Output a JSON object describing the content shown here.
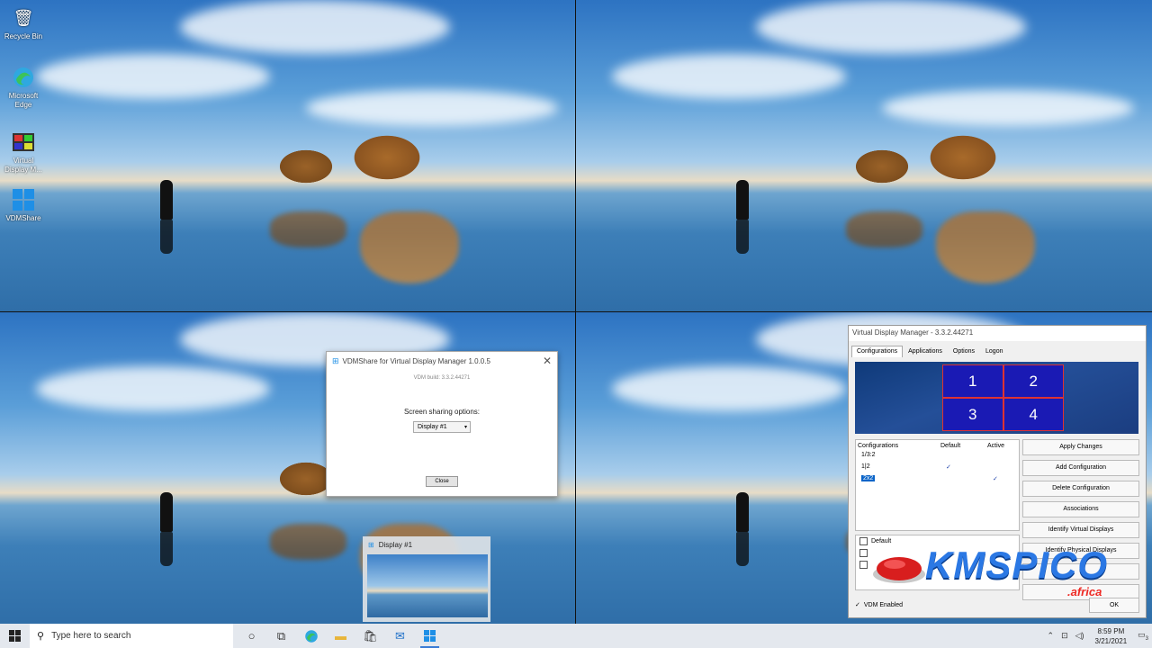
{
  "desktop": {
    "icons": [
      {
        "label": "Recycle Bin",
        "icon": "recycle-bin-icon"
      },
      {
        "label": "Microsoft Edge",
        "icon": "edge-icon"
      },
      {
        "label": "Virtual Display M...",
        "icon": "virtual-display-manager-icon"
      },
      {
        "label": "VDMShare",
        "icon": "windows-logo-icon"
      }
    ]
  },
  "vdmshare_dialog": {
    "title": "VDMShare for Virtual Display Manager 1.0.0.5",
    "build": "VDM build: 3.3.2.44271",
    "sharing_label": "Screen sharing options:",
    "selected_display": "Display #1",
    "close_label": "Close"
  },
  "thumbnail": {
    "title": "Display #1"
  },
  "vdm_window": {
    "title": "Virtual Display Manager - 3.3.2.44271",
    "tabs": [
      "Configurations",
      "Applications",
      "Options",
      "Logon"
    ],
    "active_tab": "Configurations",
    "preview_cells": [
      "1",
      "2",
      "3",
      "4"
    ],
    "config_headers": [
      "Configurations",
      "Default",
      "Active"
    ],
    "configs": [
      {
        "name": "1/3:2",
        "default": "",
        "active": ""
      },
      {
        "name": "1|2",
        "default": "✓",
        "active": ""
      },
      {
        "name": "2x2",
        "default": "",
        "active": "✓"
      }
    ],
    "buttons": [
      "Apply Changes",
      "Add Configuration",
      "Delete Configuration",
      "Associations",
      "Identify Virtual Displays",
      "Identify Physical Displays",
      "",
      ""
    ],
    "apps": [
      {
        "label": "Default"
      },
      {
        "label": ""
      },
      {
        "label": ""
      }
    ],
    "vdm_enabled_label": "VDM Enabled",
    "ok_label": "OK"
  },
  "watermark": {
    "text": "KMSPICO",
    "suffix": ".africa"
  },
  "taskbar": {
    "search_placeholder": "Type here to search",
    "time": "8:59 PM",
    "date": "3/21/2021",
    "notification_count": "3"
  },
  "colors": {
    "accent": "#0a64c8",
    "preview_cell": "#1a1ab4",
    "taskbar": "#e4e8ee"
  }
}
